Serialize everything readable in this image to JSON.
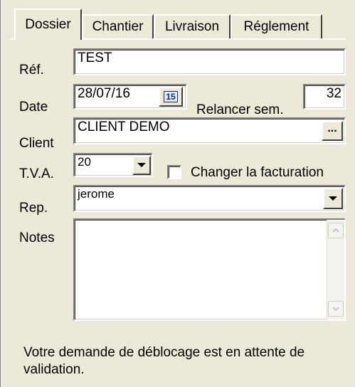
{
  "tabs": [
    {
      "label": "Dossier",
      "active": true
    },
    {
      "label": "Chantier",
      "active": false
    },
    {
      "label": "Livraison",
      "active": false
    },
    {
      "label": "Réglement",
      "active": false
    }
  ],
  "form": {
    "ref_label": "Réf.",
    "ref_value": "TEST",
    "date_label": "Date",
    "date_value": "28/07/16",
    "calendar_day": "15",
    "relancer_label": "Relancer sem.",
    "relancer_value": "32",
    "client_label": "Client",
    "client_value": "CLIENT DEMO",
    "client_button": "...",
    "tva_label": "T.V.A.",
    "tva_value": "20",
    "changer_label": "Changer la facturation",
    "changer_checked": false,
    "rep_label": "Rep.",
    "rep_value": "jerome",
    "notes_label": "Notes",
    "notes_value": ""
  },
  "message": "Votre demande de déblocage est en attente de validation.",
  "colors": {
    "background": "#ece9d8",
    "field": "#ffffff"
  },
  "icons": [
    "calendar-icon",
    "dropdown-arrow-icon",
    "scroll-up-icon",
    "scroll-down-icon"
  ]
}
